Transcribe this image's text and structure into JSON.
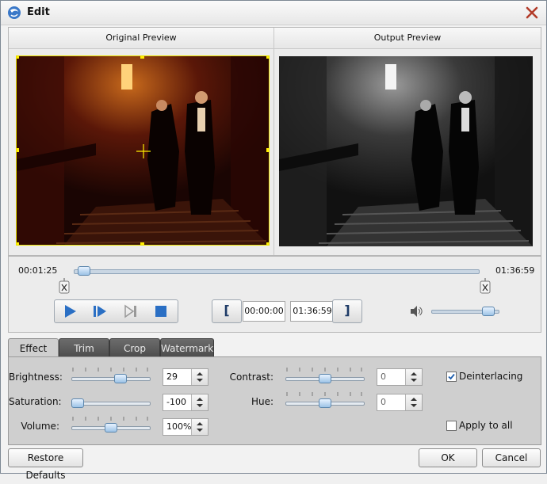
{
  "window": {
    "title": "Edit"
  },
  "preview": {
    "original_label": "Original Preview",
    "output_label": "Output Preview"
  },
  "timeline": {
    "current_time": "00:01:25",
    "end_time": "01:36:59",
    "position": 0.01
  },
  "clip": {
    "start": "00:00:00",
    "end": "01:36:59"
  },
  "volume_slider": {
    "level": 0.92
  },
  "tabs": [
    {
      "label": "Effect",
      "active": true
    },
    {
      "label": "Trim",
      "active": false
    },
    {
      "label": "Crop",
      "active": false
    },
    {
      "label": "Watermark",
      "active": false
    }
  ],
  "effect": {
    "brightness": {
      "label": "Brightness:",
      "value": "29",
      "level": 0.64
    },
    "saturation": {
      "label": "Saturation:",
      "value": "-100",
      "level": 0.0
    },
    "volume": {
      "label": "Volume:",
      "value": "100%",
      "level": 0.5
    },
    "contrast": {
      "label": "Contrast:",
      "value": "0",
      "level": 0.5
    },
    "hue": {
      "label": "Hue:",
      "value": "0",
      "level": 0.5
    },
    "deinterlacing": {
      "label": "Deinterlacing",
      "checked": true
    },
    "apply_to_all": {
      "label": "Apply to all",
      "checked": false
    }
  },
  "buttons": {
    "restore": "Restore Defaults",
    "ok": "OK",
    "cancel": "Cancel"
  },
  "colors": {
    "accent": "#3a78c8",
    "tab_dark": "#555555",
    "panel_bg": "#cfcfcf"
  }
}
